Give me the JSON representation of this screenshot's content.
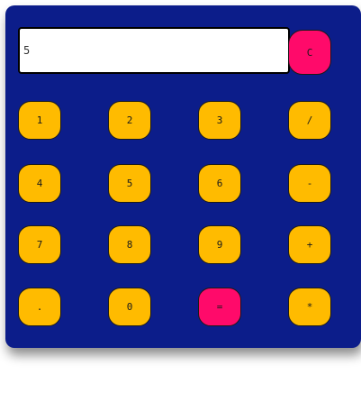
{
  "display": {
    "value": "5"
  },
  "keys": {
    "clear": "C",
    "one": "1",
    "two": "2",
    "three": "3",
    "divide": "/",
    "four": "4",
    "five": "5",
    "six": "6",
    "minus": "-",
    "seven": "7",
    "eight": "8",
    "nine": "9",
    "plus": "+",
    "decimal": ".",
    "zero": "0",
    "equals": "=",
    "multiply": "*"
  },
  "colors": {
    "body": "#0c1d8a",
    "key": "#ffbb00",
    "accent_key": "#ff0a6a",
    "display_bg": "#ffffff"
  }
}
